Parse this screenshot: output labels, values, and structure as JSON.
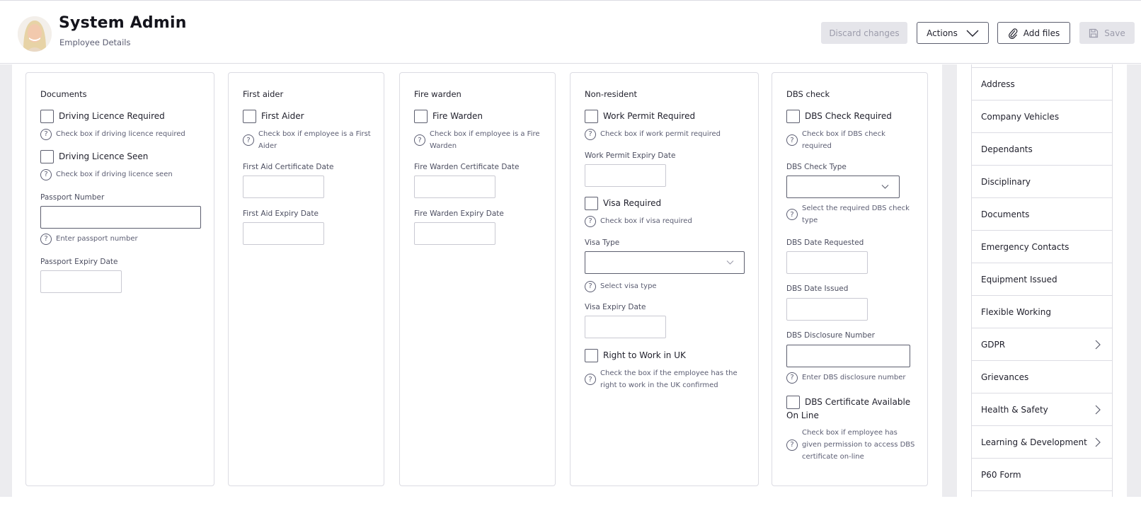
{
  "header": {
    "title": "System Admin",
    "subtitle": "Employee Details",
    "buttons": {
      "discard": "Discard changes",
      "actions": "Actions",
      "add_files": "Add files",
      "save": "Save"
    }
  },
  "cards": {
    "documents": {
      "title": "Documents",
      "driving_required": {
        "label": "Driving Licence Required",
        "hint": "Check box if driving licence required",
        "checked": false
      },
      "driving_seen": {
        "label": "Driving Licence Seen",
        "hint": "Check box if driving licence seen",
        "checked": false
      },
      "passport_number": {
        "label": "Passport Number",
        "value": "",
        "hint": "Enter passport number"
      },
      "passport_expiry": {
        "label": "Passport Expiry Date",
        "value": ""
      }
    },
    "first_aider": {
      "title": "First aider",
      "first_aider": {
        "label": "First Aider",
        "hint": "Check box if employee is a First Aider",
        "checked": false
      },
      "cert_date": {
        "label": "First Aid Certificate Date",
        "value": ""
      },
      "expiry_date": {
        "label": "First Aid Expiry Date",
        "value": ""
      }
    },
    "fire_warden": {
      "title": "Fire warden",
      "fire_warden": {
        "label": "Fire Warden",
        "hint": "Check box if employee is a Fire Warden",
        "checked": false
      },
      "cert_date": {
        "label": "Fire Warden Certificate Date",
        "value": ""
      },
      "expiry_date": {
        "label": "Fire Warden Expiry Date",
        "value": ""
      }
    },
    "non_resident": {
      "title": "Non-resident",
      "work_permit": {
        "label": "Work Permit Required",
        "hint": "Check box if work permit required",
        "checked": false
      },
      "work_permit_expiry": {
        "label": "Work Permit Expiry Date",
        "value": ""
      },
      "visa_required": {
        "label": "Visa Required",
        "hint": "Check box if visa required",
        "checked": false
      },
      "visa_type": {
        "label": "Visa Type",
        "value": "",
        "hint": "Select visa type"
      },
      "visa_expiry": {
        "label": "Visa Expiry Date",
        "value": ""
      },
      "right_to_work": {
        "label": "Right to Work in UK",
        "hint": "Check the box if the employee has the right to work in the UK confirmed",
        "checked": false
      }
    },
    "dbs_check": {
      "title": "DBS check",
      "dbs_required": {
        "label": "DBS Check Required",
        "hint": "Check box if DBS check required",
        "checked": false
      },
      "dbs_type": {
        "label": "DBS Check Type",
        "value": "",
        "hint": "Select the required DBS check type"
      },
      "date_requested": {
        "label": "DBS Date Requested",
        "value": ""
      },
      "date_issued": {
        "label": "DBS Date Issued",
        "value": ""
      },
      "disclosure_number": {
        "label": "DBS Disclosure Number",
        "value": "",
        "hint": "Enter DBS disclosure number"
      },
      "cert_online": {
        "label": "DBS Certificate Available On Line",
        "hint": "Check box if employee has given permission to access DBS certificate on-line",
        "checked": false
      }
    }
  },
  "sidenav": {
    "items": [
      {
        "label": "Address",
        "has_submenu": false
      },
      {
        "label": "Company Vehicles",
        "has_submenu": false
      },
      {
        "label": "Dependants",
        "has_submenu": false
      },
      {
        "label": "Disciplinary",
        "has_submenu": false
      },
      {
        "label": "Documents",
        "has_submenu": false
      },
      {
        "label": "Emergency Contacts",
        "has_submenu": false
      },
      {
        "label": "Equipment Issued",
        "has_submenu": false
      },
      {
        "label": "Flexible Working",
        "has_submenu": false
      },
      {
        "label": "GDPR",
        "has_submenu": true
      },
      {
        "label": "Grievances",
        "has_submenu": false
      },
      {
        "label": "Health & Safety",
        "has_submenu": true
      },
      {
        "label": "Learning & Development",
        "has_submenu": true
      },
      {
        "label": "P60 Form",
        "has_submenu": false
      }
    ]
  }
}
